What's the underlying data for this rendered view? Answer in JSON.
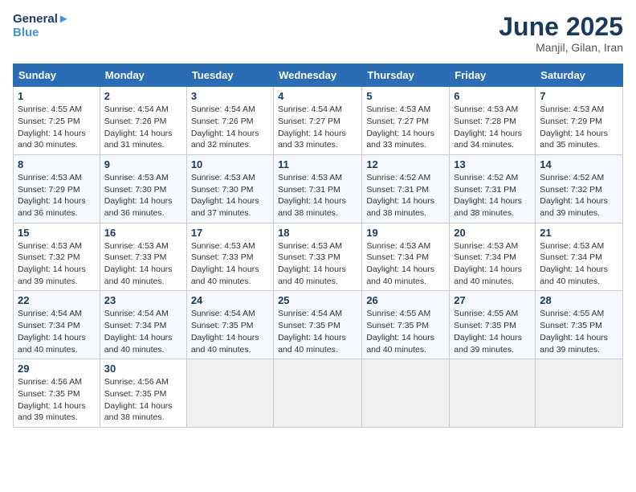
{
  "header": {
    "logo_line1": "General",
    "logo_line2": "Blue",
    "month": "June 2025",
    "location": "Manjil, Gilan, Iran"
  },
  "weekdays": [
    "Sunday",
    "Monday",
    "Tuesday",
    "Wednesday",
    "Thursday",
    "Friday",
    "Saturday"
  ],
  "weeks": [
    [
      {
        "day": 1,
        "sunrise": "4:55 AM",
        "sunset": "7:25 PM",
        "daylight": "14 hours and 30 minutes."
      },
      {
        "day": 2,
        "sunrise": "4:54 AM",
        "sunset": "7:26 PM",
        "daylight": "14 hours and 31 minutes."
      },
      {
        "day": 3,
        "sunrise": "4:54 AM",
        "sunset": "7:26 PM",
        "daylight": "14 hours and 32 minutes."
      },
      {
        "day": 4,
        "sunrise": "4:54 AM",
        "sunset": "7:27 PM",
        "daylight": "14 hours and 33 minutes."
      },
      {
        "day": 5,
        "sunrise": "4:53 AM",
        "sunset": "7:27 PM",
        "daylight": "14 hours and 33 minutes."
      },
      {
        "day": 6,
        "sunrise": "4:53 AM",
        "sunset": "7:28 PM",
        "daylight": "14 hours and 34 minutes."
      },
      {
        "day": 7,
        "sunrise": "4:53 AM",
        "sunset": "7:29 PM",
        "daylight": "14 hours and 35 minutes."
      }
    ],
    [
      {
        "day": 8,
        "sunrise": "4:53 AM",
        "sunset": "7:29 PM",
        "daylight": "14 hours and 36 minutes."
      },
      {
        "day": 9,
        "sunrise": "4:53 AM",
        "sunset": "7:30 PM",
        "daylight": "14 hours and 36 minutes."
      },
      {
        "day": 10,
        "sunrise": "4:53 AM",
        "sunset": "7:30 PM",
        "daylight": "14 hours and 37 minutes."
      },
      {
        "day": 11,
        "sunrise": "4:53 AM",
        "sunset": "7:31 PM",
        "daylight": "14 hours and 38 minutes."
      },
      {
        "day": 12,
        "sunrise": "4:52 AM",
        "sunset": "7:31 PM",
        "daylight": "14 hours and 38 minutes."
      },
      {
        "day": 13,
        "sunrise": "4:52 AM",
        "sunset": "7:31 PM",
        "daylight": "14 hours and 38 minutes."
      },
      {
        "day": 14,
        "sunrise": "4:52 AM",
        "sunset": "7:32 PM",
        "daylight": "14 hours and 39 minutes."
      }
    ],
    [
      {
        "day": 15,
        "sunrise": "4:53 AM",
        "sunset": "7:32 PM",
        "daylight": "14 hours and 39 minutes."
      },
      {
        "day": 16,
        "sunrise": "4:53 AM",
        "sunset": "7:33 PM",
        "daylight": "14 hours and 40 minutes."
      },
      {
        "day": 17,
        "sunrise": "4:53 AM",
        "sunset": "7:33 PM",
        "daylight": "14 hours and 40 minutes."
      },
      {
        "day": 18,
        "sunrise": "4:53 AM",
        "sunset": "7:33 PM",
        "daylight": "14 hours and 40 minutes."
      },
      {
        "day": 19,
        "sunrise": "4:53 AM",
        "sunset": "7:34 PM",
        "daylight": "14 hours and 40 minutes."
      },
      {
        "day": 20,
        "sunrise": "4:53 AM",
        "sunset": "7:34 PM",
        "daylight": "14 hours and 40 minutes."
      },
      {
        "day": 21,
        "sunrise": "4:53 AM",
        "sunset": "7:34 PM",
        "daylight": "14 hours and 40 minutes."
      }
    ],
    [
      {
        "day": 22,
        "sunrise": "4:54 AM",
        "sunset": "7:34 PM",
        "daylight": "14 hours and 40 minutes."
      },
      {
        "day": 23,
        "sunrise": "4:54 AM",
        "sunset": "7:34 PM",
        "daylight": "14 hours and 40 minutes."
      },
      {
        "day": 24,
        "sunrise": "4:54 AM",
        "sunset": "7:35 PM",
        "daylight": "14 hours and 40 minutes."
      },
      {
        "day": 25,
        "sunrise": "4:54 AM",
        "sunset": "7:35 PM",
        "daylight": "14 hours and 40 minutes."
      },
      {
        "day": 26,
        "sunrise": "4:55 AM",
        "sunset": "7:35 PM",
        "daylight": "14 hours and 40 minutes."
      },
      {
        "day": 27,
        "sunrise": "4:55 AM",
        "sunset": "7:35 PM",
        "daylight": "14 hours and 39 minutes."
      },
      {
        "day": 28,
        "sunrise": "4:55 AM",
        "sunset": "7:35 PM",
        "daylight": "14 hours and 39 minutes."
      }
    ],
    [
      {
        "day": 29,
        "sunrise": "4:56 AM",
        "sunset": "7:35 PM",
        "daylight": "14 hours and 39 minutes."
      },
      {
        "day": 30,
        "sunrise": "4:56 AM",
        "sunset": "7:35 PM",
        "daylight": "14 hours and 38 minutes."
      },
      null,
      null,
      null,
      null,
      null
    ]
  ]
}
